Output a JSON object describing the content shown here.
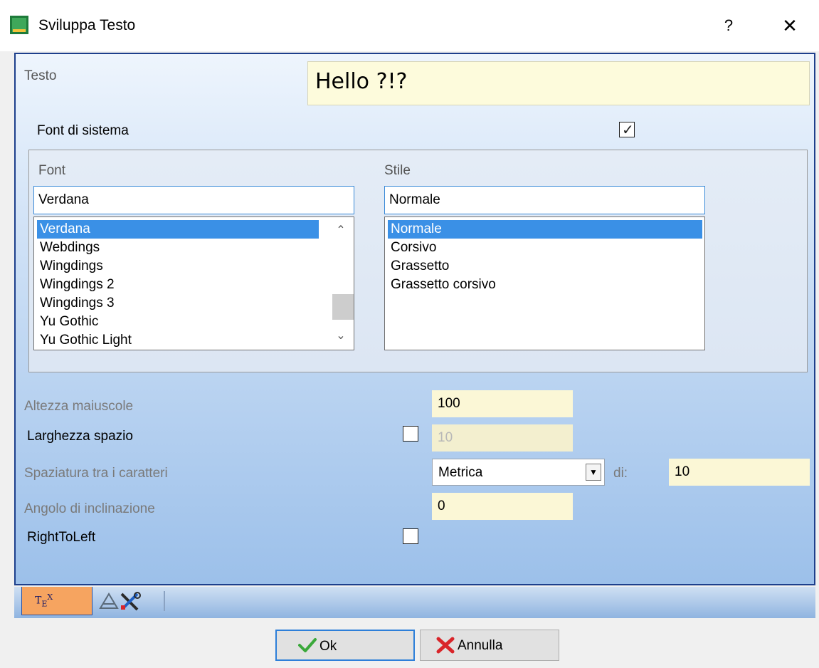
{
  "window": {
    "title": "Sviluppa Testo",
    "help_label": "?",
    "close_label": "✕"
  },
  "text": {
    "label": "Testo",
    "value": "Hello ?!?"
  },
  "system_font": {
    "label": "Font di sistema",
    "checked": true
  },
  "font": {
    "label": "Font",
    "value": "Verdana",
    "list": [
      "Verdana",
      "Webdings",
      "Wingdings",
      "Wingdings 2",
      "Wingdings 3",
      "Yu Gothic",
      "Yu Gothic Light"
    ],
    "selected": "Verdana"
  },
  "style": {
    "label": "Stile",
    "value": "Normale",
    "list": [
      "Normale",
      "Corsivo",
      "Grassetto",
      "Grassetto corsivo"
    ],
    "selected": "Normale"
  },
  "cap_height": {
    "label": "Altezza maiuscole",
    "value": "100"
  },
  "space_width": {
    "label": "Larghezza spazio",
    "checked": false,
    "value": "10"
  },
  "char_spacing": {
    "label": "Spaziatura tra i caratteri",
    "mode": "Metrica",
    "of_label": "di:",
    "value": "10"
  },
  "slant_angle": {
    "label": "Angolo di inclinazione",
    "value": "0"
  },
  "rtl": {
    "label": "RightToLeft",
    "checked": false
  },
  "tabs": [
    {
      "name": "text-tab",
      "label": "TEX"
    },
    {
      "name": "tools-tab",
      "icon": "tools-icon"
    }
  ],
  "buttons": {
    "ok": "Ok",
    "cancel": "Annulla"
  },
  "colors": {
    "accent": "#3a90e6",
    "panel_border": "#1d3f8c",
    "field_bg": "#fbf7d6",
    "active_tab": "#f6a460"
  }
}
